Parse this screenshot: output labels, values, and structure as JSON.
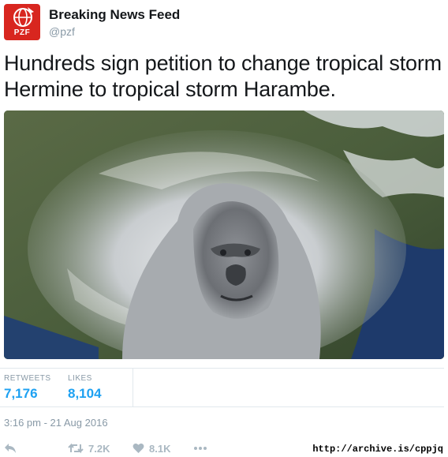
{
  "account": {
    "name": "Breaking News Feed",
    "handle": "@pzf",
    "avatar_text": "PZF"
  },
  "tweet": {
    "text": "Hundreds sign petition to change tropical storm Hermine to tropical storm Harambe.",
    "timestamp": "3:16 pm - 21 Aug 2016"
  },
  "stats": {
    "retweets_label": "RETWEETS",
    "retweets_value": "7,176",
    "likes_label": "LIKES",
    "likes_value": "8,104"
  },
  "actions": {
    "retweet_count": "7.2K",
    "like_count": "8.1K"
  },
  "watermark": "http://archive.is/cppjq",
  "colors": {
    "brand_red": "#d8261f",
    "link_blue": "#1da1f2",
    "muted_gray": "#8899a6"
  }
}
